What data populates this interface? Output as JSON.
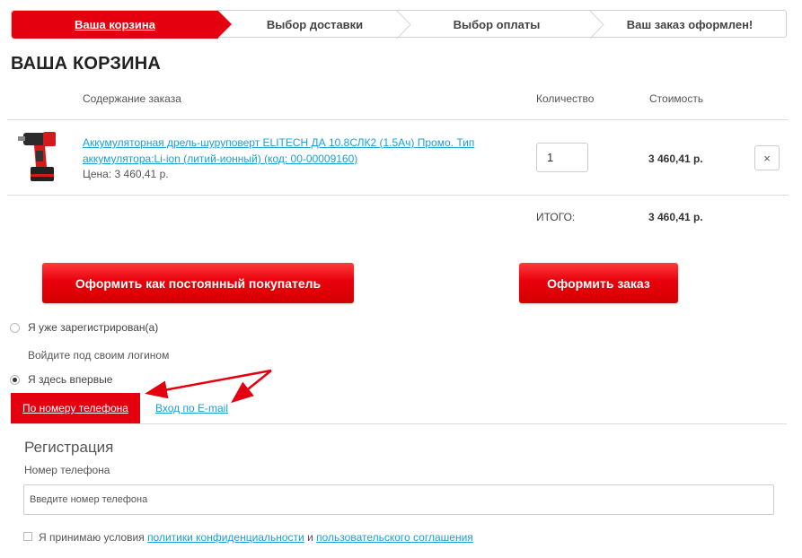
{
  "steps": [
    {
      "label": "Ваша корзина",
      "active": true
    },
    {
      "label": "Выбор доставки",
      "active": false
    },
    {
      "label": "Выбор оплаты",
      "active": false
    },
    {
      "label": "Ваш заказ оформлен!",
      "active": false
    }
  ],
  "page_title": "ВАША КОРЗИНА",
  "table": {
    "headers": {
      "content": "Содержание заказа",
      "quantity": "Количество",
      "cost": "Стоимость"
    },
    "rows": [
      {
        "product_name": "Аккумуляторная дрель-шуруповерт ELITECH ДА 10.8СЛК2 (1.5Ач) Промо. Тип аккумулятора:Li-ion (литий-ионный) (код: 00-00009160)",
        "price_line": "Цена: 3 460,41 р.",
        "quantity": "1",
        "cost": "3 460,41 р.",
        "remove_icon": "×"
      }
    ],
    "total_label": "ИТОГО:",
    "total_value": "3 460,41 р."
  },
  "buttons": {
    "regular_customer": "Оформить как постоянный покупатель",
    "place_order": "Оформить заказ"
  },
  "auth": {
    "registered_label": "Я уже зарегистрирован(а)",
    "login_hint": "Войдите под своим логином",
    "first_time_label": "Я здесь впервые",
    "selected": "first_time",
    "tabs": {
      "phone": "По номеру телефона",
      "email": "Вход по E-mail"
    }
  },
  "registration": {
    "title": "Регистрация",
    "phone_label": "Номер телефона",
    "phone_placeholder": "Введите номер телефона",
    "phone_value": "",
    "agree_prefix": "Я принимаю условия",
    "privacy_link": "политики конфиденциальности",
    "agree_and": "и",
    "user_agreement_link": "пользовательского соглашения",
    "agreed": false
  },
  "colors": {
    "accent": "#e4000f",
    "link": "#1a9fd8"
  }
}
